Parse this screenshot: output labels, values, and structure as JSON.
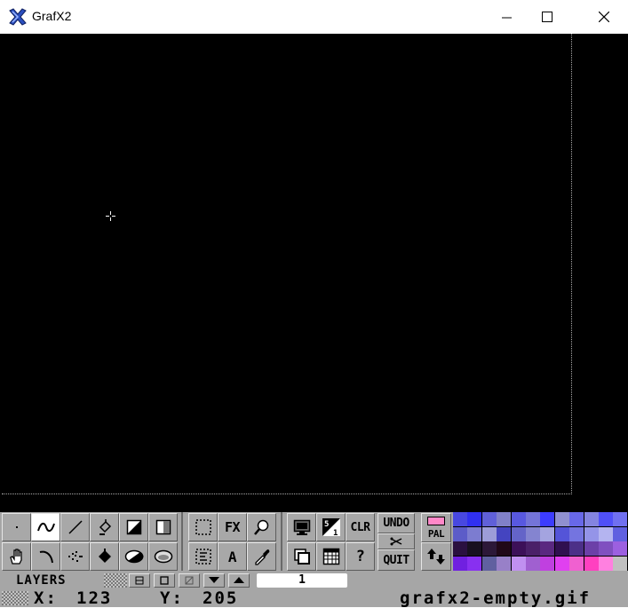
{
  "window": {
    "title": "GrafX2"
  },
  "toolbar": {
    "effects_label": "FX",
    "text_tool_label": "A",
    "clear_label": "CLR",
    "undo_label": "UNDO",
    "quit_label": "QUIT",
    "palette_label": "PAL",
    "help_label": "?"
  },
  "palette": {
    "fore_color": "#ff88c8",
    "swatches": [
      "#4848e0",
      "#3030f0",
      "#6060d8",
      "#8080c8",
      "#5858e0",
      "#7474d8",
      "#3c3cff",
      "#9090d0",
      "#6868e8",
      "#8484e0",
      "#5050f8",
      "#7070f0",
      "#5c5cc8",
      "#7c7cd0",
      "#9c9cd8",
      "#4444c0",
      "#6464c8",
      "#8484d0",
      "#a4a4e0",
      "#5454d8",
      "#7474e0",
      "#9494e8",
      "#b4b4f0",
      "#6060e0",
      "#2a1040",
      "#181020",
      "#2c1838",
      "#200818",
      "#3c1058",
      "#4a2068",
      "#5a2880",
      "#301050",
      "#4c3088",
      "#6c40a8",
      "#8050c0",
      "#9c60e0",
      "#7020e0",
      "#8830f0",
      "#6060a0",
      "#9880c8",
      "#c090f0",
      "#a060d0",
      "#c040e0",
      "#e040f0",
      "#f060d0",
      "#ff40c0",
      "#ff80e0",
      "#c0c0c0"
    ]
  },
  "layers": {
    "label": "LAYERS",
    "current": "1"
  },
  "status": {
    "x_label": "X:",
    "x_value": "123",
    "y_label": "Y:",
    "y_value": "205",
    "filename": "grafx2-empty.gif"
  }
}
